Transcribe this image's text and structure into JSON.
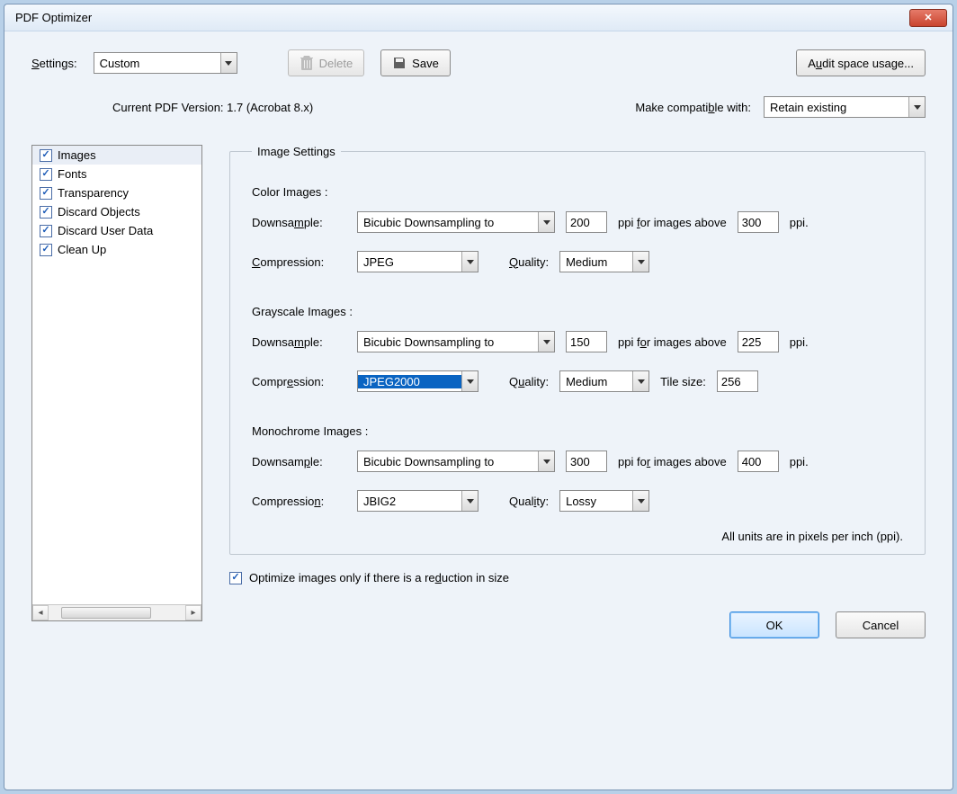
{
  "window": {
    "title": "PDF Optimizer"
  },
  "top": {
    "settings_label": "Settings:",
    "settings_value": "Custom",
    "delete_label": "Delete",
    "save_label": "Save",
    "audit_label": "Audit space usage..."
  },
  "version": {
    "current_label": "Current PDF Version: 1.7 (Acrobat 8.x)",
    "compat_label": "Make compatible with:",
    "compat_value": "Retain existing"
  },
  "sidebar": {
    "items": [
      {
        "label": "Images",
        "checked": true,
        "selected": true
      },
      {
        "label": "Fonts",
        "checked": true,
        "selected": false
      },
      {
        "label": "Transparency",
        "checked": true,
        "selected": false
      },
      {
        "label": "Discard Objects",
        "checked": true,
        "selected": false
      },
      {
        "label": "Discard User Data",
        "checked": true,
        "selected": false
      },
      {
        "label": "Clean Up",
        "checked": true,
        "selected": false
      }
    ]
  },
  "panel": {
    "legend": "Image Settings",
    "color": {
      "title": "Color Images :",
      "downsample_label": "Downsample:",
      "downsample_method": "Bicubic Downsampling to",
      "ppi_value": "200",
      "for_above_label": "ppi for images above",
      "ppi_threshold": "300",
      "ppi_suffix": "ppi.",
      "compression_label": "Compression:",
      "compression_value": "JPEG",
      "quality_label": "Quality:",
      "quality_value": "Medium"
    },
    "gray": {
      "title": "Grayscale Images :",
      "downsample_label": "Downsample:",
      "downsample_method": "Bicubic Downsampling to",
      "ppi_value": "150",
      "for_above_label": "ppi for images above",
      "ppi_threshold": "225",
      "ppi_suffix": "ppi.",
      "compression_label": "Compression:",
      "compression_value": "JPEG2000",
      "quality_label": "Quality:",
      "quality_value": "Medium",
      "tile_label": "Tile size:",
      "tile_value": "256"
    },
    "mono": {
      "title": "Monochrome Images :",
      "downsample_label": "Downsample:",
      "downsample_method": "Bicubic Downsampling to",
      "ppi_value": "300",
      "for_above_label": "ppi for images above",
      "ppi_threshold": "400",
      "ppi_suffix": "ppi.",
      "compression_label": "Compression:",
      "compression_value": "JBIG2",
      "quality_label": "Quality:",
      "quality_value": "Lossy"
    },
    "footnote": "All units are in pixels per inch (ppi).",
    "optimize_only_label": "Optimize images only if there is a reduction in size",
    "optimize_only_checked": true
  },
  "buttons": {
    "ok": "OK",
    "cancel": "Cancel"
  }
}
